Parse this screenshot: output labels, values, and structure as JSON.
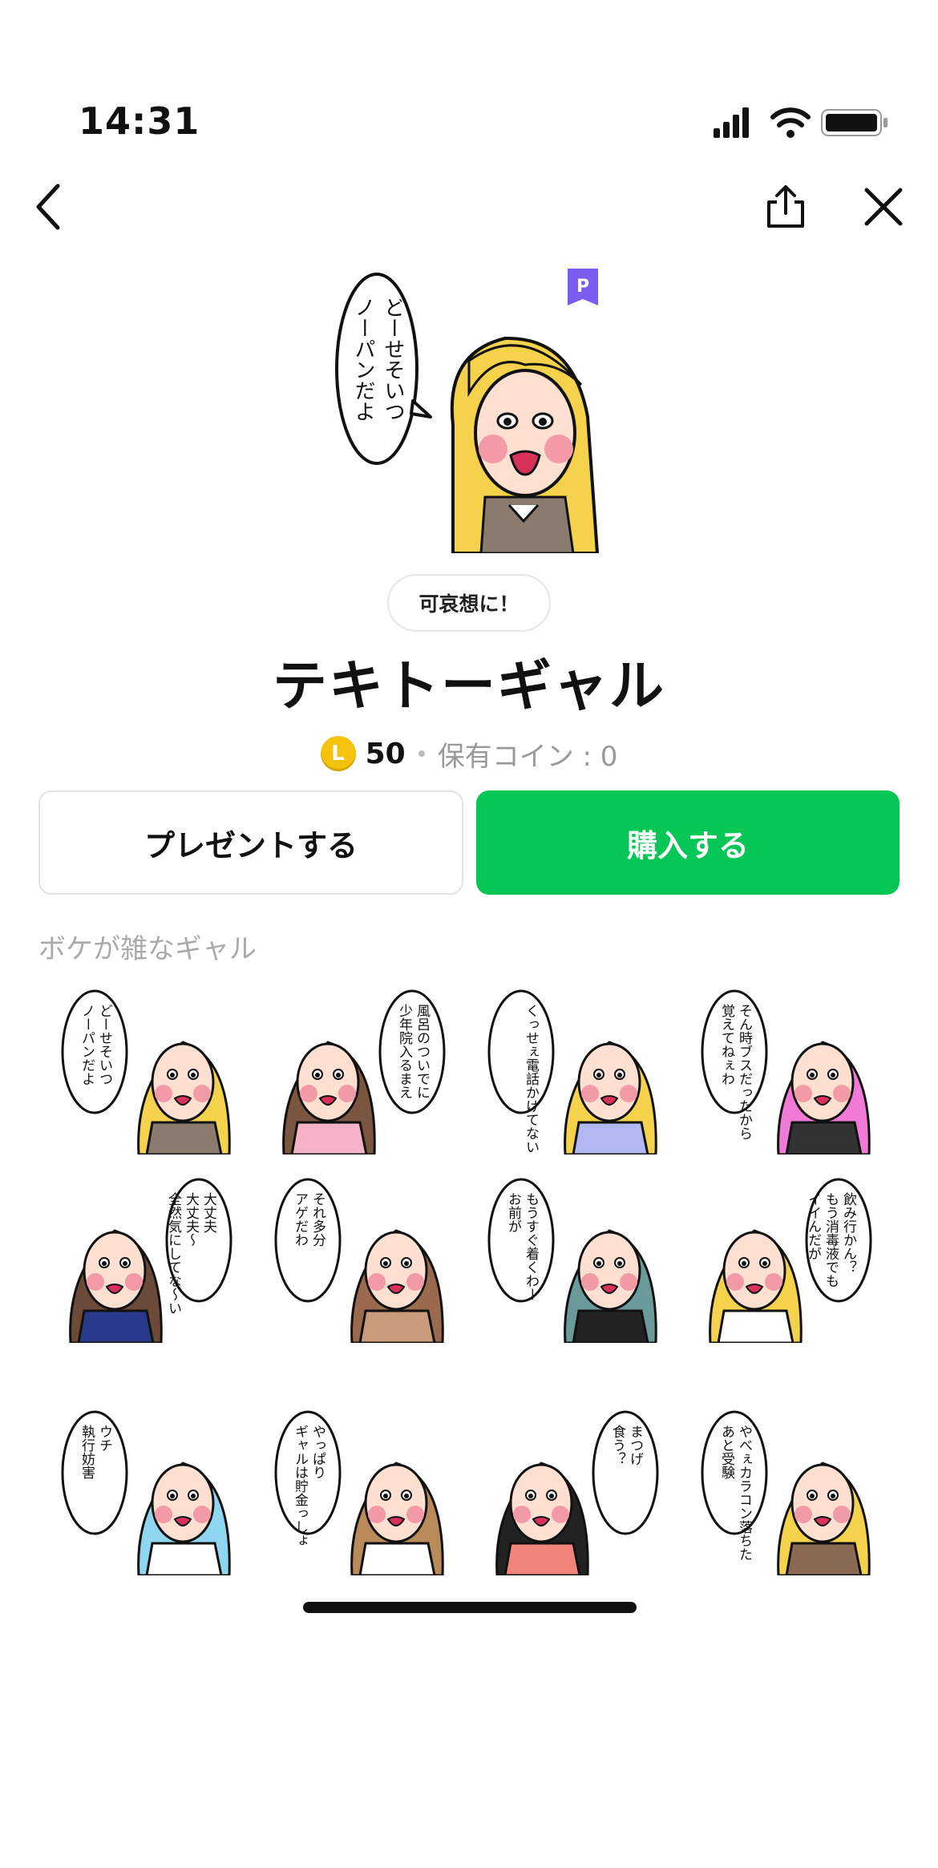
{
  "status": {
    "time": "14:31"
  },
  "nav": {
    "back": "back-icon",
    "share": "share-icon",
    "close": "close-icon"
  },
  "hero": {
    "bubble_text": "どーせそいつ ノーパンだよ",
    "premium_badge": "P"
  },
  "catchphrase": "可哀想に！",
  "title": "テキトーギャル",
  "price": {
    "coin_symbol": "L",
    "amount": "50",
    "owned_label": "保有コイン : 0"
  },
  "buttons": {
    "present": "プレゼントする",
    "buy": "購入する"
  },
  "colors": {
    "buy_green": "#06c755",
    "coin_gold": "#f4c20d",
    "premium_purple": "#7b5cf0"
  },
  "set_caption": "ボケが雑なギャル",
  "stickers": [
    {
      "text": "どーせそいつ ノーパンだよ",
      "hair": "#f5d24b",
      "top": "#8b7b6f"
    },
    {
      "text": "風呂のついでに 少年院入るまえ",
      "hair": "#7a5540",
      "top": "#f6b3c6"
    },
    {
      "text": "くっせぇ電話かけてないっ？",
      "hair": "#f5d24b",
      "top": "#b3b7f2"
    },
    {
      "text": "そん時ブスだったから 覚えてねぇわ",
      "hair": "#f07ad6",
      "top": "#333333"
    },
    {
      "text": "大丈夫 大丈夫〜 全然気にしてな〜い",
      "hair": "#6b4a3a",
      "top": "#2a3a8a"
    },
    {
      "text": "それ多分 アゲだわ",
      "hair": "#9b6a4e",
      "top": "#c89b7b"
    },
    {
      "text": "もうすぐ着くわー お前が",
      "hair": "#6a9a9a",
      "top": "#222222"
    },
    {
      "text": "飲み行かん？ もう消毒液でも イイんだが",
      "hair": "#f5d24b",
      "top": "#ffffff"
    },
    {
      "text": "ウチ 執行妨害",
      "hair": "#8fd6f0",
      "top": "#ffffff"
    },
    {
      "text": "やっぱり ギャルは貯金っしょ",
      "hair": "#b98a5a",
      "top": "#ffffff"
    },
    {
      "text": "まつげ 食う？",
      "hair": "#222222",
      "top": "#f2857a"
    },
    {
      "text": "やべぇカラコン落ちた あと受験",
      "hair": "#f5d24b",
      "top": "#8a6a55"
    }
  ]
}
